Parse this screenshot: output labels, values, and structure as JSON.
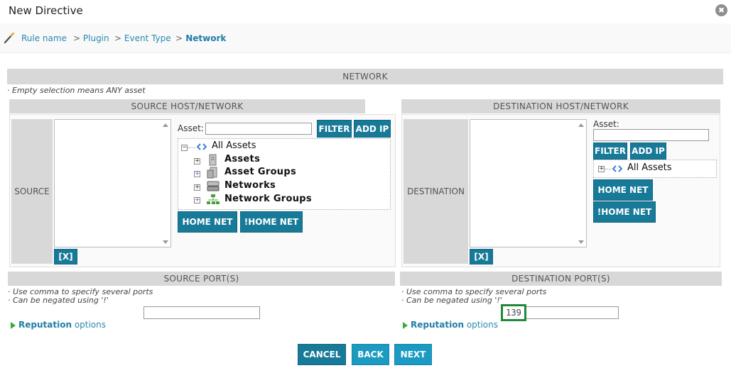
{
  "dialog": {
    "title": "New Directive",
    "close_glyph": "✖"
  },
  "breadcrumb": {
    "items": [
      "Rule name",
      "Plugin",
      "Event Type",
      "Network"
    ],
    "separator": ">"
  },
  "network": {
    "header": "NETWORK",
    "note": "· Empty selection means ANY asset"
  },
  "source": {
    "header": "SOURCE HOST/NETWORK",
    "side_label": "SOURCE",
    "asset_label": "Asset:",
    "asset_value": "",
    "filter_label": "FILTER",
    "add_ip_label": "ADD IP",
    "tree": {
      "root": "All Assets",
      "children": [
        "Assets",
        "Asset Groups",
        "Networks",
        "Network Groups"
      ]
    },
    "home_net_label": "HOME NET",
    "not_home_net_label": "!HOME NET",
    "clear_label": "[X]"
  },
  "destination": {
    "header": "DESTINATION HOST/NETWORK",
    "side_label": "DESTINATION",
    "asset_label": "Asset:",
    "asset_value": "",
    "filter_label": "FILTER",
    "add_ip_label": "ADD IP",
    "tree": {
      "root": "All Assets"
    },
    "home_net_label": "HOME NET",
    "not_home_net_label": "!HOME NET",
    "clear_label": "[X]"
  },
  "source_port": {
    "header": "SOURCE PORT(S)",
    "note1": "· Use comma to specify several ports",
    "note2": "· Can be negated using '!'",
    "value": "",
    "reputation_bold": "Reputation",
    "reputation_rest": "options"
  },
  "destination_port": {
    "header": "DESTINATION PORT(S)",
    "note1": "· Use comma to specify several ports",
    "note2": "· Can be negated using '!'",
    "value": "139",
    "reputation_bold": "Reputation",
    "reputation_rest": "options"
  },
  "footer": {
    "cancel": "CANCEL",
    "back": "BACK",
    "next": "NEXT"
  },
  "colors": {
    "button": "#177a98",
    "button_light": "#1b9ac2",
    "link": "#2a8ab0",
    "highlight": "#1e8a3a"
  }
}
